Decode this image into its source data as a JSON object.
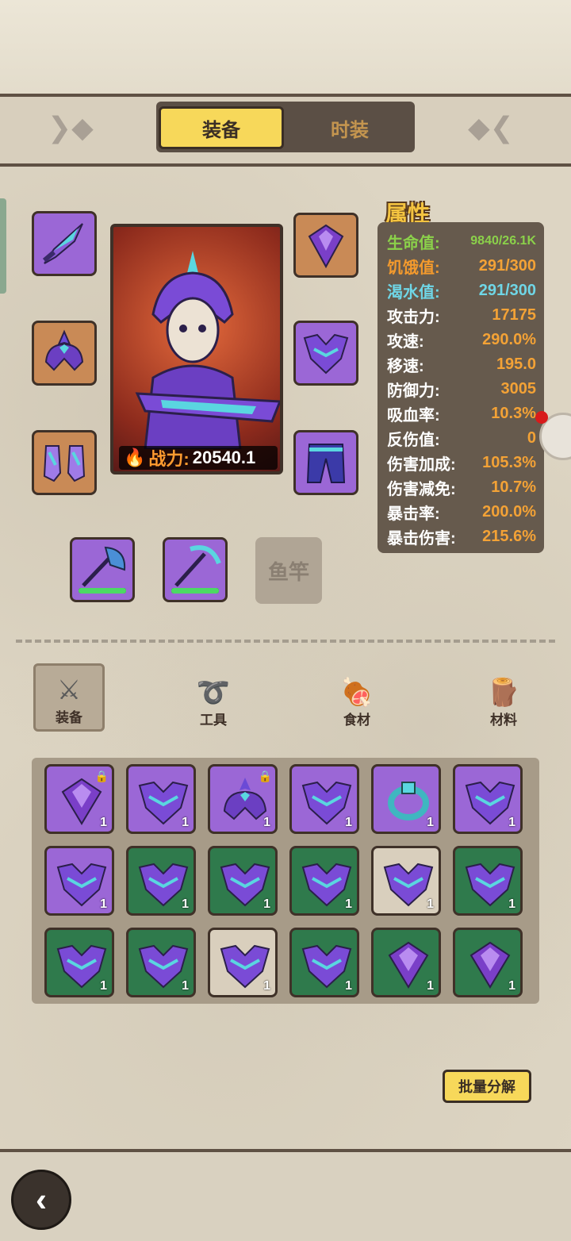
{
  "tabs": {
    "equipment": "装备",
    "costume": "时装"
  },
  "character": {
    "power_label": "战力:",
    "power_value": "20540.1"
  },
  "attributes": {
    "title": "属性",
    "rows": [
      {
        "label": "生命值:",
        "value": "9840/26.1K",
        "label_color": "#8bd14a",
        "value_color": "#8bd14a"
      },
      {
        "label": "饥饿值:",
        "value": "291/300",
        "label_color": "#f39a2d",
        "value_color": "#f39a2d"
      },
      {
        "label": "渴水值:",
        "value": "291/300",
        "label_color": "#6fd6e6",
        "value_color": "#6fd6e6"
      },
      {
        "label": "攻击力:",
        "value": "17175"
      },
      {
        "label": "攻速:",
        "value": "290.0%"
      },
      {
        "label": "移速:",
        "value": "195.0"
      },
      {
        "label": "防御力:",
        "value": "3005"
      },
      {
        "label": "吸血率:",
        "value": "10.3%"
      },
      {
        "label": "反伤值:",
        "value": "0"
      },
      {
        "label": "伤害加成:",
        "value": "105.3%"
      },
      {
        "label": "伤害减免:",
        "value": "10.7%"
      },
      {
        "label": "暴击率:",
        "value": "200.0%"
      },
      {
        "label": "暴击伤害:",
        "value": "215.6%"
      }
    ]
  },
  "tools": {
    "fishing_rod_label": "鱼竿"
  },
  "categories": {
    "equipment": "装备",
    "tools": "工具",
    "food": "食材",
    "materials": "材料"
  },
  "inventory": [
    {
      "item": "gem",
      "bg": "purple",
      "count": "1",
      "locked": true
    },
    {
      "item": "armor",
      "bg": "purple",
      "count": "1",
      "locked": false
    },
    {
      "item": "helmet",
      "bg": "purple",
      "count": "1",
      "locked": true
    },
    {
      "item": "armor",
      "bg": "purple",
      "count": "1",
      "locked": false
    },
    {
      "item": "ring",
      "bg": "purple",
      "count": "1",
      "locked": false
    },
    {
      "item": "armor",
      "bg": "purple",
      "count": "1",
      "locked": false
    },
    {
      "item": "armor",
      "bg": "purple",
      "count": "1",
      "locked": false
    },
    {
      "item": "armor",
      "bg": "green",
      "count": "1",
      "locked": false
    },
    {
      "item": "armor",
      "bg": "green",
      "count": "1",
      "locked": false
    },
    {
      "item": "armor",
      "bg": "green",
      "count": "1",
      "locked": false
    },
    {
      "item": "armor",
      "bg": "white",
      "count": "1",
      "locked": false
    },
    {
      "item": "armor",
      "bg": "green",
      "count": "1",
      "locked": false
    },
    {
      "item": "armor",
      "bg": "green",
      "count": "1",
      "locked": false
    },
    {
      "item": "armor",
      "bg": "green",
      "count": "1",
      "locked": false
    },
    {
      "item": "armor",
      "bg": "white",
      "count": "1",
      "locked": false
    },
    {
      "item": "armor",
      "bg": "green",
      "count": "1",
      "locked": false
    },
    {
      "item": "gem",
      "bg": "green",
      "count": "1",
      "locked": false
    },
    {
      "item": "gem",
      "bg": "green",
      "count": "1",
      "locked": false
    }
  ],
  "batch_button": "批量分解"
}
